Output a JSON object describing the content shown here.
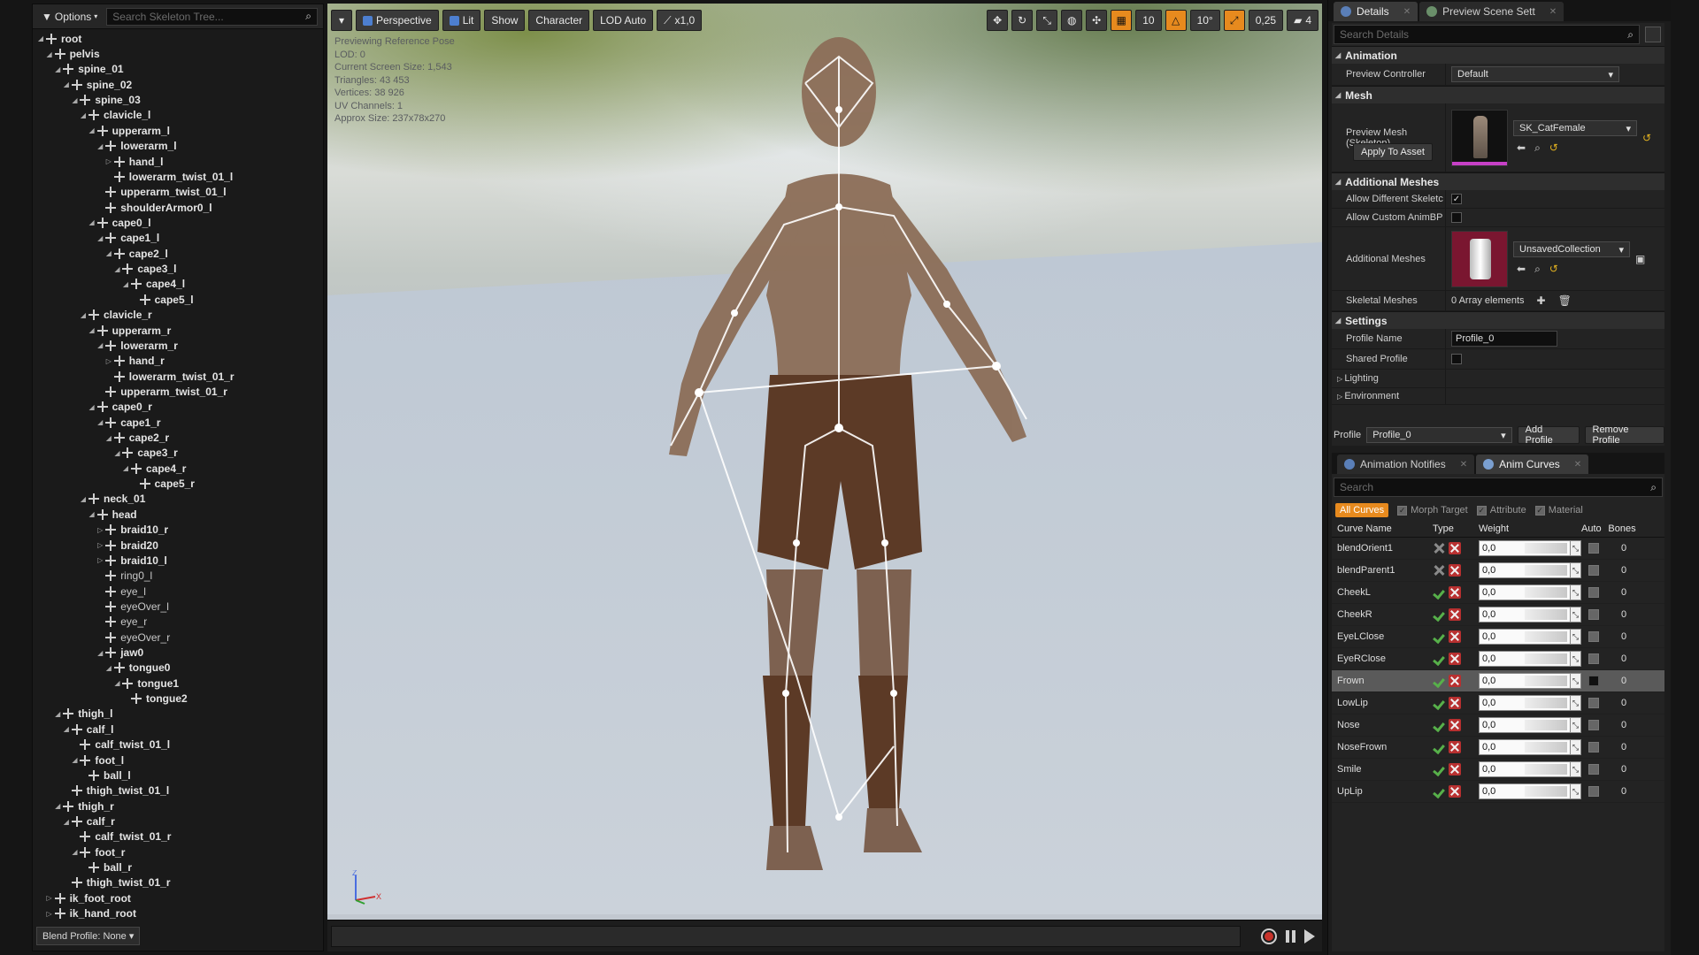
{
  "skeleton_tree": {
    "options_label": "Options",
    "search_placeholder": "Search Skeleton Tree...",
    "blend_profile_label": "Blend Profile: None",
    "bones": [
      {
        "name": "root",
        "depth": 0,
        "arrow": "open",
        "style": "bold"
      },
      {
        "name": "pelvis",
        "depth": 1,
        "arrow": "open",
        "style": "bold"
      },
      {
        "name": "spine_01",
        "depth": 2,
        "arrow": "open",
        "style": "bold"
      },
      {
        "name": "spine_02",
        "depth": 3,
        "arrow": "open",
        "style": "bold"
      },
      {
        "name": "spine_03",
        "depth": 4,
        "arrow": "open",
        "style": "bold"
      },
      {
        "name": "clavicle_l",
        "depth": 5,
        "arrow": "open",
        "style": "bold"
      },
      {
        "name": "upperarm_l",
        "depth": 6,
        "arrow": "open",
        "style": "bold"
      },
      {
        "name": "lowerarm_l",
        "depth": 7,
        "arrow": "open",
        "style": "bold"
      },
      {
        "name": "hand_l",
        "depth": 8,
        "arrow": "closed",
        "style": "bold"
      },
      {
        "name": "lowerarm_twist_01_l",
        "depth": 8,
        "arrow": "none",
        "style": "bold"
      },
      {
        "name": "upperarm_twist_01_l",
        "depth": 7,
        "arrow": "none",
        "style": "bold"
      },
      {
        "name": "shoulderArmor0_l",
        "depth": 7,
        "arrow": "none",
        "style": "bold"
      },
      {
        "name": "cape0_l",
        "depth": 6,
        "arrow": "open",
        "style": "bold"
      },
      {
        "name": "cape1_l",
        "depth": 7,
        "arrow": "open",
        "style": "bold"
      },
      {
        "name": "cape2_l",
        "depth": 8,
        "arrow": "open",
        "style": "bold"
      },
      {
        "name": "cape3_l",
        "depth": 9,
        "arrow": "open",
        "style": "bold"
      },
      {
        "name": "cape4_l",
        "depth": 10,
        "arrow": "open",
        "style": "bold"
      },
      {
        "name": "cape5_l",
        "depth": 11,
        "arrow": "none",
        "style": "bold"
      },
      {
        "name": "clavicle_r",
        "depth": 5,
        "arrow": "open",
        "style": "bold"
      },
      {
        "name": "upperarm_r",
        "depth": 6,
        "arrow": "open",
        "style": "bold"
      },
      {
        "name": "lowerarm_r",
        "depth": 7,
        "arrow": "open",
        "style": "bold"
      },
      {
        "name": "hand_r",
        "depth": 8,
        "arrow": "closed",
        "style": "bold"
      },
      {
        "name": "lowerarm_twist_01_r",
        "depth": 8,
        "arrow": "none",
        "style": "bold"
      },
      {
        "name": "upperarm_twist_01_r",
        "depth": 7,
        "arrow": "none",
        "style": "bold"
      },
      {
        "name": "cape0_r",
        "depth": 6,
        "arrow": "open",
        "style": "bold"
      },
      {
        "name": "cape1_r",
        "depth": 7,
        "arrow": "open",
        "style": "bold"
      },
      {
        "name": "cape2_r",
        "depth": 8,
        "arrow": "open",
        "style": "bold"
      },
      {
        "name": "cape3_r",
        "depth": 9,
        "arrow": "open",
        "style": "bold"
      },
      {
        "name": "cape4_r",
        "depth": 10,
        "arrow": "open",
        "style": "bold"
      },
      {
        "name": "cape5_r",
        "depth": 11,
        "arrow": "none",
        "style": "bold"
      },
      {
        "name": "neck_01",
        "depth": 5,
        "arrow": "open",
        "style": "bold"
      },
      {
        "name": "head",
        "depth": 6,
        "arrow": "open",
        "style": "bold"
      },
      {
        "name": "braid10_r",
        "depth": 7,
        "arrow": "closed",
        "style": "bold"
      },
      {
        "name": "braid20",
        "depth": 7,
        "arrow": "closed",
        "style": "bold"
      },
      {
        "name": "braid10_l",
        "depth": 7,
        "arrow": "closed",
        "style": "bold"
      },
      {
        "name": "ring0_l",
        "depth": 7,
        "arrow": "none",
        "style": "plain"
      },
      {
        "name": "eye_l",
        "depth": 7,
        "arrow": "none",
        "style": "plain"
      },
      {
        "name": "eyeOver_l",
        "depth": 7,
        "arrow": "none",
        "style": "plain"
      },
      {
        "name": "eye_r",
        "depth": 7,
        "arrow": "none",
        "style": "plain"
      },
      {
        "name": "eyeOver_r",
        "depth": 7,
        "arrow": "none",
        "style": "plain"
      },
      {
        "name": "jaw0",
        "depth": 7,
        "arrow": "open",
        "style": "bold"
      },
      {
        "name": "tongue0",
        "depth": 8,
        "arrow": "open",
        "style": "bold"
      },
      {
        "name": "tongue1",
        "depth": 9,
        "arrow": "open",
        "style": "bold"
      },
      {
        "name": "tongue2",
        "depth": 10,
        "arrow": "none",
        "style": "bold"
      },
      {
        "name": "thigh_l",
        "depth": 2,
        "arrow": "open",
        "style": "bold"
      },
      {
        "name": "calf_l",
        "depth": 3,
        "arrow": "open",
        "style": "bold"
      },
      {
        "name": "calf_twist_01_l",
        "depth": 4,
        "arrow": "none",
        "style": "bold"
      },
      {
        "name": "foot_l",
        "depth": 4,
        "arrow": "open",
        "style": "bold"
      },
      {
        "name": "ball_l",
        "depth": 5,
        "arrow": "none",
        "style": "bold"
      },
      {
        "name": "thigh_twist_01_l",
        "depth": 3,
        "arrow": "none",
        "style": "bold"
      },
      {
        "name": "thigh_r",
        "depth": 2,
        "arrow": "open",
        "style": "bold"
      },
      {
        "name": "calf_r",
        "depth": 3,
        "arrow": "open",
        "style": "bold"
      },
      {
        "name": "calf_twist_01_r",
        "depth": 4,
        "arrow": "none",
        "style": "bold"
      },
      {
        "name": "foot_r",
        "depth": 4,
        "arrow": "open",
        "style": "bold"
      },
      {
        "name": "ball_r",
        "depth": 5,
        "arrow": "none",
        "style": "bold"
      },
      {
        "name": "thigh_twist_01_r",
        "depth": 3,
        "arrow": "none",
        "style": "bold"
      },
      {
        "name": "ik_foot_root",
        "depth": 1,
        "arrow": "closed",
        "style": "bold"
      },
      {
        "name": "ik_hand_root",
        "depth": 1,
        "arrow": "closed",
        "style": "bold"
      }
    ]
  },
  "viewport": {
    "toolbar": {
      "perspective": "Perspective",
      "lit": "Lit",
      "show": "Show",
      "character": "Character",
      "lod": "LOD Auto",
      "speed": "x1,0",
      "grid_value": "10",
      "angle_value": "10°",
      "scale_value": "0,25",
      "camera_speed": "4"
    },
    "stats": [
      "Previewing Reference Pose",
      "LOD: 0",
      "Current Screen Size: 1,543",
      "Triangles: 43 453",
      "Vertices: 38 926",
      "UV Channels: 1",
      "Approx Size: 237x78x270"
    ],
    "axis": {
      "z": "Z",
      "x": "X"
    }
  },
  "details": {
    "tabs": [
      {
        "label": "Details",
        "active": true
      },
      {
        "label": "Preview Scene Sett",
        "active": false
      }
    ],
    "search_placeholder": "Search Details",
    "animation": {
      "title": "Animation",
      "preview_controller_label": "Preview Controller",
      "preview_controller_value": "Default"
    },
    "mesh": {
      "title": "Mesh",
      "preview_mesh_label": "Preview Mesh (Skeleton)",
      "preview_mesh_value": "SK_CatFemale",
      "apply_button": "Apply To Asset"
    },
    "additional_meshes": {
      "title": "Additional Meshes",
      "allow_different_label": "Allow Different Skeletc",
      "allow_different_checked": true,
      "allow_custom_label": "Allow Custom AnimBP",
      "allow_custom_checked": false,
      "additional_meshes_label": "Additional Meshes",
      "additional_meshes_value": "UnsavedCollection",
      "skeletal_meshes_label": "Skeletal Meshes",
      "skeletal_meshes_value": "0 Array elements"
    },
    "settings": {
      "title": "Settings",
      "profile_name_label": "Profile Name",
      "profile_name_value": "Profile_0",
      "shared_profile_label": "Shared Profile",
      "lighting_label": "Lighting",
      "environment_label": "Environment"
    },
    "profile_bar": {
      "label": "Profile",
      "value": "Profile_0",
      "add_button": "Add Profile",
      "remove_button": "Remove Profile"
    }
  },
  "anim_curves": {
    "tabs": [
      {
        "label": "Animation Notifies",
        "active": false
      },
      {
        "label": "Anim Curves",
        "active": true
      }
    ],
    "search_placeholder": "Search",
    "filters": {
      "all": "All Curves",
      "morph": "Morph Target",
      "attribute": "Attribute",
      "material": "Material"
    },
    "columns": {
      "name": "Curve Name",
      "type": "Type",
      "weight": "Weight",
      "auto": "Auto",
      "bones": "Bones"
    },
    "curves": [
      {
        "name": "blendOrient1",
        "morph": false,
        "weight": "0,0",
        "auto": false,
        "bones": "0",
        "selected": false
      },
      {
        "name": "blendParent1",
        "morph": false,
        "weight": "0,0",
        "auto": false,
        "bones": "0",
        "selected": false
      },
      {
        "name": "CheekL",
        "morph": true,
        "weight": "0,0",
        "auto": false,
        "bones": "0",
        "selected": false
      },
      {
        "name": "CheekR",
        "morph": true,
        "weight": "0,0",
        "auto": false,
        "bones": "0",
        "selected": false
      },
      {
        "name": "EyeLClose",
        "morph": true,
        "weight": "0,0",
        "auto": false,
        "bones": "0",
        "selected": false
      },
      {
        "name": "EyeRClose",
        "morph": true,
        "weight": "0,0",
        "auto": false,
        "bones": "0",
        "selected": false
      },
      {
        "name": "Frown",
        "morph": true,
        "weight": "0,0",
        "auto": true,
        "bones": "0",
        "selected": true
      },
      {
        "name": "LowLip",
        "morph": true,
        "weight": "0,0",
        "auto": false,
        "bones": "0",
        "selected": false
      },
      {
        "name": "Nose",
        "morph": true,
        "weight": "0,0",
        "auto": false,
        "bones": "0",
        "selected": false
      },
      {
        "name": "NoseFrown",
        "morph": true,
        "weight": "0,0",
        "auto": false,
        "bones": "0",
        "selected": false
      },
      {
        "name": "Smile",
        "morph": true,
        "weight": "0,0",
        "auto": false,
        "bones": "0",
        "selected": false
      },
      {
        "name": "UpLip",
        "morph": true,
        "weight": "0,0",
        "auto": false,
        "bones": "0",
        "selected": false
      }
    ]
  },
  "colors": {
    "accent_orange": "#e78a1e",
    "selection_grey": "#5a5a5a",
    "morph_green": "#57b04a",
    "delete_red": "#b83030"
  }
}
